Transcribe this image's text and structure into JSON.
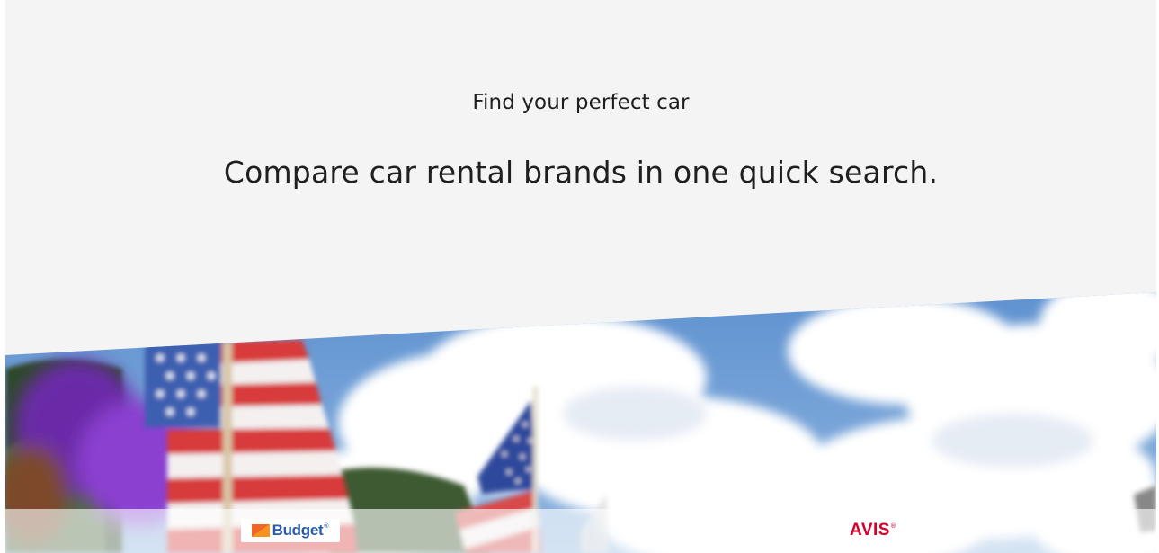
{
  "hero": {
    "eyebrow": "Find your perfect car",
    "headline": "Compare car rental brands in one quick search."
  },
  "brands": [
    {
      "name": "Budget",
      "logo_text": "Budget",
      "mark": "®",
      "color": "#2b5aa6",
      "accent": "#f26522"
    },
    {
      "name": "Avis",
      "logo_text": "AVIS",
      "mark": "®",
      "color": "#d4002a"
    }
  ],
  "colors": {
    "background": "#f4f4f4",
    "text": "#1f1f1f",
    "sky": "#6e9fd3"
  },
  "image": {
    "icon": "flags-sky-photo"
  }
}
